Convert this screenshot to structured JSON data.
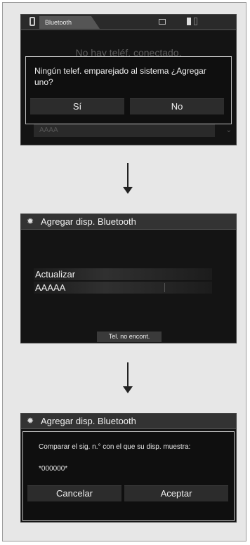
{
  "screen1": {
    "tab_label": "Bluetooth",
    "background_text": "No hay teléf. conectado.",
    "background_row": "AAAA",
    "dialog_message": "Ningún telef. emparejado al sistema ¿Agregar uno?",
    "yes_button": "Sí",
    "no_button": "No"
  },
  "screen2": {
    "title": "Agregar disp. Bluetooth",
    "items": [
      "Actualizar",
      "AAAAA"
    ],
    "footer_button": "Tel. no encont."
  },
  "screen3": {
    "title": "Agregar disp. Bluetooth",
    "message": "Comparar el sig. n.° con el que su disp. muestra:",
    "code": "*000000*",
    "cancel_button": "Cancelar",
    "accept_button": "Aceptar"
  },
  "icons": [
    "phone-icon",
    "signal-icon",
    "battery-icon",
    "settings-gear-icon",
    "down-arrow-icon"
  ]
}
